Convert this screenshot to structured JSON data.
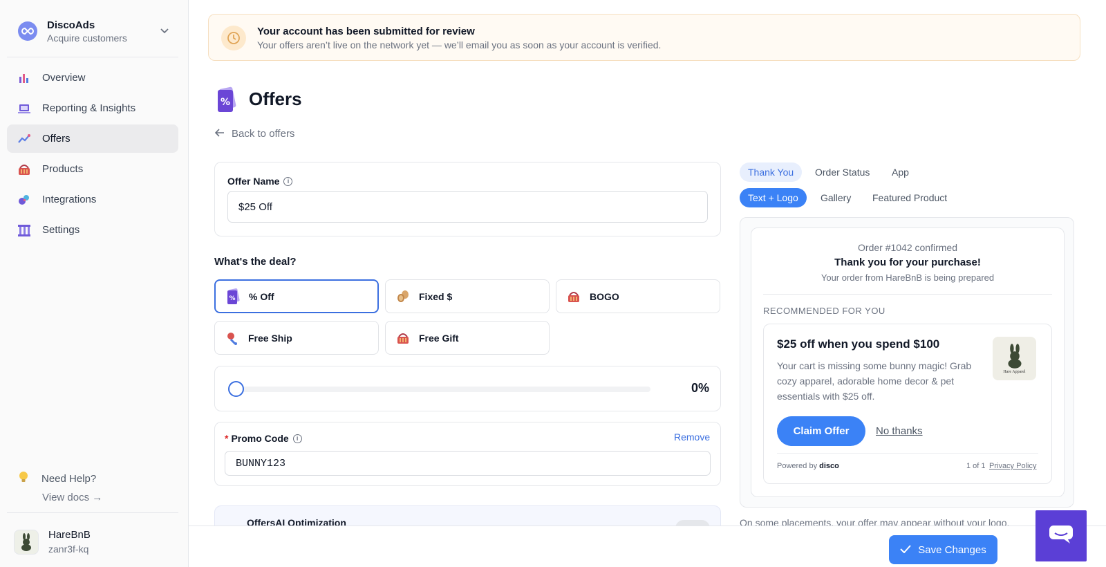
{
  "sidebar": {
    "brand": {
      "name": "DiscoAds",
      "subtitle": "Acquire customers"
    },
    "items": [
      {
        "label": "Overview",
        "icon": "overview-icon"
      },
      {
        "label": "Reporting & Insights",
        "icon": "reporting-icon"
      },
      {
        "label": "Offers",
        "icon": "offers-icon",
        "active": true
      },
      {
        "label": "Products",
        "icon": "products-icon"
      },
      {
        "label": "Integrations",
        "icon": "integrations-icon"
      },
      {
        "label": "Settings",
        "icon": "settings-icon"
      }
    ],
    "help": {
      "label": "Need Help?",
      "docs_link": "View docs →"
    },
    "account": {
      "name": "HareBnB",
      "id": "zanr3f-kq"
    }
  },
  "banner": {
    "title": "Your account has been submitted for review",
    "message": "Your offers aren’t live on the network yet — we’ll email you as soon as your account is verified."
  },
  "page": {
    "title": "Offers",
    "back_link": "Back to offers"
  },
  "form": {
    "offer_name": {
      "label": "Offer Name",
      "value": "$25 Off"
    },
    "deal_section_label": "What's the deal?",
    "deal_types": [
      {
        "label": "% Off",
        "icon": "percent-tag-icon",
        "selected": true
      },
      {
        "label": "Fixed $",
        "icon": "coins-icon",
        "selected": false
      },
      {
        "label": "BOGO",
        "icon": "gift-basket-icon",
        "selected": false
      },
      {
        "label": "Free Ship",
        "icon": "shipping-icon",
        "selected": false
      },
      {
        "label": "Free Gift",
        "icon": "gift-basket-icon",
        "selected": false
      }
    ],
    "discount": {
      "value_label": "0%",
      "value_percent": 0
    },
    "promo_code": {
      "required_mark": "*",
      "label": "Promo Code",
      "remove_label": "Remove",
      "value": "BUNNY123"
    },
    "ai_optimization": {
      "title": "OffersAI Optimization",
      "enabled": false
    }
  },
  "footer": {
    "save_label": "Save Changes"
  },
  "preview": {
    "placement_tabs": [
      "Thank You",
      "Order Status",
      "App"
    ],
    "layout_tabs": [
      "Text + Logo",
      "Gallery",
      "Featured Product"
    ],
    "order_confirmed": "Order #1042 confirmed",
    "thanks": "Thank you for your purchase!",
    "order_prep": "Your order from HareBnB is being prepared",
    "recommended_label": "RECOMMENDED FOR YOU",
    "offer": {
      "title": "$25 off when you spend $100",
      "description": "Your cart is missing some bunny magic! Grab cozy apparel, adorable home decor & pet essentials with $25 off.",
      "logo_text": "Hare Apparel",
      "claim_label": "Claim Offer",
      "decline_label": "No thanks",
      "powered_by": "Powered by",
      "powered_brand": "disco",
      "pager": "1 of 1",
      "privacy": "Privacy Policy"
    },
    "note": "On some placements, your offer may appear without your logo."
  },
  "colors": {
    "accent": "#3b82f6",
    "selected_border": "#3b6fe0",
    "banner_bg": "#fffaf3",
    "chat_button": "#5b3fd6"
  }
}
